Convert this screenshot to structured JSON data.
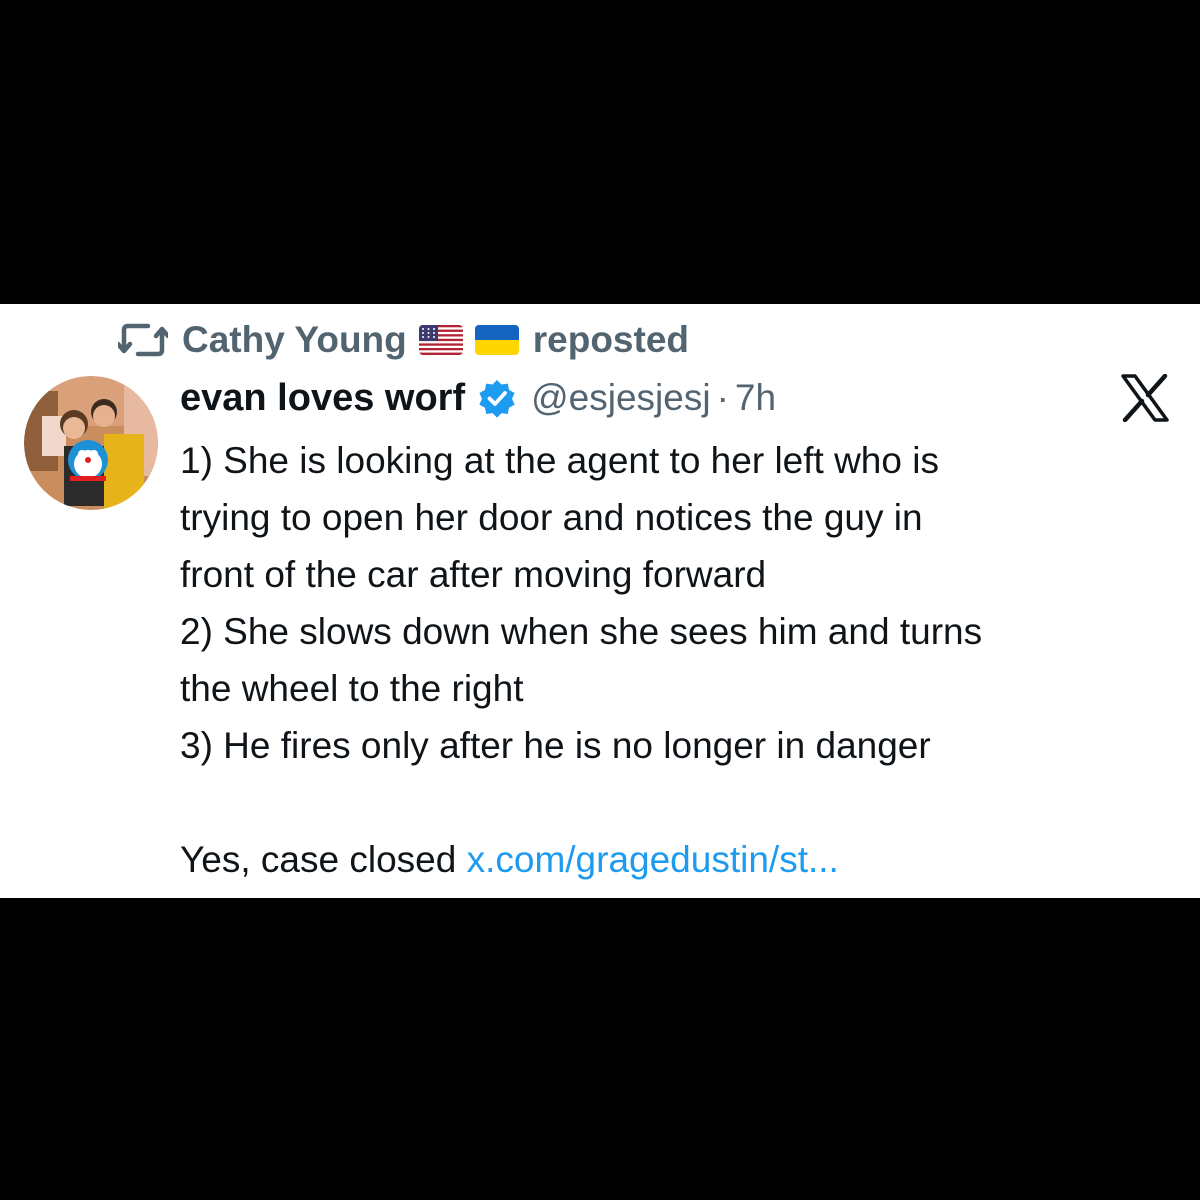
{
  "repost": {
    "icon": "repost-icon",
    "name": "Cathy Young",
    "flags": [
      "us-flag",
      "ukraine-flag"
    ],
    "label": "reposted"
  },
  "tweet": {
    "display_name": "evan loves worf",
    "verified_icon": "verified-badge-icon",
    "handle": "@esjesjesj",
    "separator": "·",
    "timestamp": "7h",
    "lines": [
      "1) She is looking at the agent to her left who is",
      "trying to open her door and notices the guy in",
      "front of the car after moving forward",
      "2) She slows down when she sees him and turns",
      "the wheel to the right",
      "3) He fires only after he is no longer in danger"
    ],
    "closing_text": "Yes, case closed ",
    "link_text": "x.com/gragedustin/st..."
  },
  "colors": {
    "link": "#1d9bf0",
    "secondary_text": "#536471",
    "primary_text": "#0f1419",
    "verified": "#1d9bf0",
    "background": "#000000",
    "card": "#ffffff"
  }
}
